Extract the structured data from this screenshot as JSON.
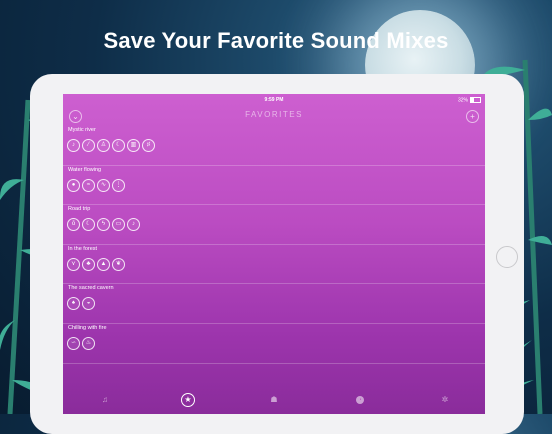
{
  "headline": "Save Your Favorite Sound Mixes",
  "status": {
    "time": "9:59 PM",
    "battery": "32%"
  },
  "nav": {
    "title": "FAVORITES",
    "left_icon": "chevron-down-icon",
    "right_icon": "plus-icon"
  },
  "favorites": [
    {
      "name": "Mystic river",
      "icons": [
        "guitar-icon",
        "flute-icon",
        "wind-chime-icon",
        "moon-icon",
        "piano-icon",
        "violin-icon"
      ]
    },
    {
      "name": "Water flowing",
      "icons": [
        "water-drop-icon",
        "stream-icon",
        "waves-icon",
        "rain-icon"
      ]
    },
    {
      "name": "Road trip",
      "icons": [
        "owl-icon",
        "moon-icon",
        "lightning-icon",
        "car-icon",
        "guitar-icon"
      ]
    },
    {
      "name": "In the forest",
      "icons": [
        "bird-icon",
        "tree-icon",
        "campfire-icon",
        "leaf-icon"
      ]
    },
    {
      "name": "The sacred cavern",
      "icons": [
        "bell-icon",
        "cave-icon"
      ]
    },
    {
      "name": "Chilling with fire",
      "icons": [
        "wind-icon",
        "fire-icon"
      ]
    }
  ],
  "tabs": [
    "music-note-icon",
    "star-icon",
    "cat-icon",
    "timer-icon",
    "gear-icon"
  ],
  "colors": {
    "accent": "#bb4cc2",
    "night": "#0e2d48"
  }
}
